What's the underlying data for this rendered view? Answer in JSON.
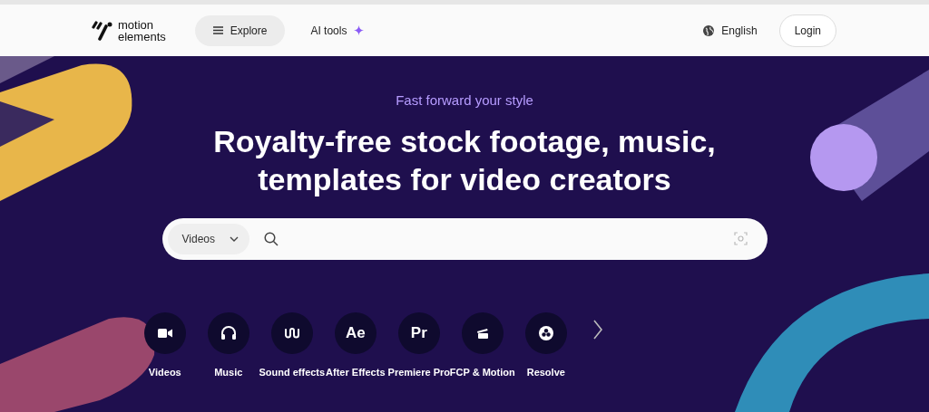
{
  "header": {
    "logo": {
      "line_1": "motion",
      "line_2": "elements"
    },
    "nav": [
      {
        "label": "Explore",
        "selected": true
      },
      {
        "label": "AI tools",
        "selected": false
      }
    ],
    "language": "English",
    "login": "Login"
  },
  "hero": {
    "tagline": "Fast forward your style",
    "headline_lines": [
      "Royalty-free stock footage, music,",
      "templates for video creators"
    ],
    "search": {
      "category": "Videos"
    },
    "categories": [
      {
        "kind": "icon",
        "label": "Videos"
      },
      {
        "kind": "icon",
        "label": "Music"
      },
      {
        "kind": "icon",
        "label": "Sound effects"
      },
      {
        "kind": "glyph",
        "glyph": "Ae",
        "label": "After Effects"
      },
      {
        "kind": "glyph",
        "glyph": "Pr",
        "label": "Premiere Pro"
      },
      {
        "kind": "icon",
        "label": "FCP & Motion"
      },
      {
        "kind": "icon",
        "label": "Resolve"
      }
    ]
  }
}
